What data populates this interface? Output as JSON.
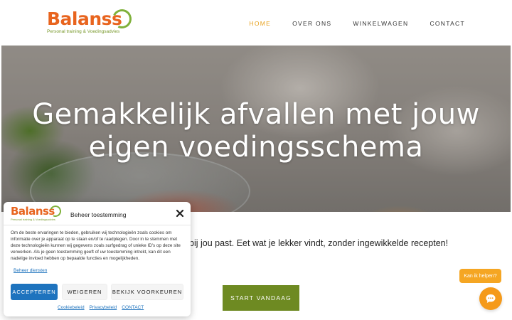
{
  "header": {
    "logo_text_main": "Balan",
    "logo_text_accent": "ss",
    "logo_tagline": "Personal training & Voedingsadvies",
    "nav": [
      {
        "label": "HOME",
        "active": true
      },
      {
        "label": "OVER ONS",
        "active": false
      },
      {
        "label": "WINKELWAGEN",
        "active": false
      },
      {
        "label": "CONTACT",
        "active": false
      }
    ]
  },
  "hero": {
    "title_line1": "Gemakkelijk afvallen met jouw",
    "title_line2": "eigen voedingsschema"
  },
  "main": {
    "tagline": "bij jou past. Eet wat je lekker vindt, zonder ingewikkelde recepten!",
    "cta_label": "START VANDAAG"
  },
  "chat": {
    "bubble_label": "Kan ik helpen?",
    "icon": "chat-icon"
  },
  "cookie": {
    "title": "Beheer toestemming",
    "body": "Om de beste ervaringen te bieden, gebruiken wij technologieën zoals cookies om informatie over je apparaat op te slaan en/of te raadplegen. Door in te stemmen met deze technologieën kunnen wij gegevens zoals surfgedrag of unieke ID's op deze site verwerken. Als je geen toestemming geeft of uw toestemming intrekt, kan dit een nadelige invloed hebben op bepaalde functies en mogelijkheden.",
    "manage_link": "Beheer diensten",
    "accept_label": "ACCEPTEREN",
    "deny_label": "WEIGEREN",
    "prefs_label": "BEKIJK VOORKEUREN",
    "footer_links": [
      "Cookiebeleid",
      "Privacybeleid",
      "CONTACT"
    ]
  },
  "colors": {
    "brand_orange": "#e8641e",
    "brand_green": "#7fb13b",
    "nav_active": "#e8a21e",
    "cta_green": "#6e8a22",
    "accept_blue": "#1e73be",
    "chat_orange": "#f59a1a"
  }
}
